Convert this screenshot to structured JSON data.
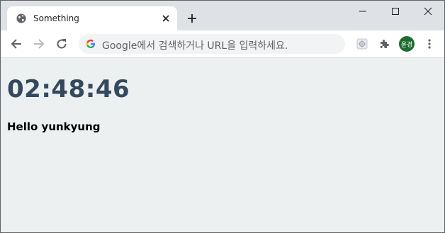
{
  "tab": {
    "title": "Something"
  },
  "omnibox": {
    "placeholder": "Google에서 검색하거나 URL을 입력하세요."
  },
  "profile": {
    "avatar_text": "윤경"
  },
  "page": {
    "clock": "02:48:46",
    "greeting": "Hello yunkyung"
  },
  "icons": {
    "favicon": "globe-icon",
    "tab_close": "close-icon",
    "new_tab": "plus-icon",
    "back": "arrow-left-icon",
    "forward": "arrow-right-icon",
    "reload": "reload-icon",
    "search_engine": "google-icon",
    "extension": "extension-icon",
    "extensions_menu": "puzzle-icon",
    "menu": "more-vert-icon"
  },
  "colors": {
    "clock_text": "#34495e",
    "page_background": "#ecf0f1",
    "avatar_background": "#1e6b30"
  }
}
